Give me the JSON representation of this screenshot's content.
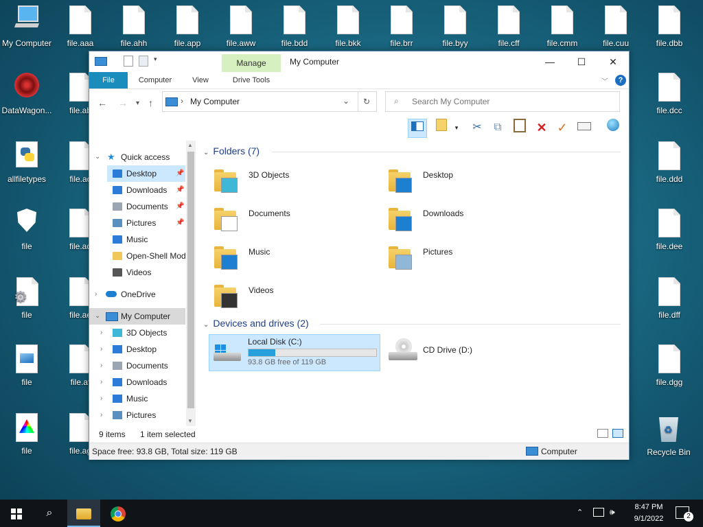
{
  "desktop": {
    "left_icons": [
      {
        "label": "My Computer",
        "kind": "pc"
      },
      {
        "label": "DataWagon...",
        "kind": "web"
      },
      {
        "label": "allfiletypes",
        "kind": "python"
      },
      {
        "label": "file",
        "kind": "shield"
      },
      {
        "label": "file",
        "kind": "gear"
      },
      {
        "label": "file",
        "kind": "image"
      },
      {
        "label": "file",
        "kind": "triangle"
      }
    ],
    "second_column": [
      "file.aaa",
      "file.ab",
      "file.ac",
      "file.ad",
      "file.ae",
      "file.af",
      "file.ag"
    ],
    "top_row": [
      "file.ahh",
      "file.app",
      "file.aww",
      "file.bdd",
      "file.bkk",
      "file.brr",
      "file.byy",
      "file.cff",
      "file.cmm",
      "file.cuu",
      "file.dbb"
    ],
    "right_column": [
      "file.dcc",
      "file.ddd",
      "file.dee",
      "file.dff",
      "file.dgg"
    ],
    "recycle_bin": "Recycle Bin"
  },
  "window": {
    "title": "My Computer",
    "manage_tab": "Manage",
    "ribbon_tabs": [
      "File",
      "Computer",
      "View",
      "Drive Tools"
    ],
    "controls": {
      "minimize": "—",
      "maximize": "☐",
      "close": "✕"
    },
    "address": "My Computer",
    "search_placeholder": "Search My Computer",
    "nav": {
      "quick_access": "Quick access",
      "quick_items": [
        {
          "label": "Desktop",
          "pinned": true,
          "color": "#2b7bd8"
        },
        {
          "label": "Downloads",
          "pinned": true,
          "color": "#2b7bd8"
        },
        {
          "label": "Documents",
          "pinned": true,
          "color": "#9aa6b2"
        },
        {
          "label": "Pictures",
          "pinned": true,
          "color": "#5b8fbf"
        },
        {
          "label": "Music",
          "pinned": false,
          "color": "#2b7bd8"
        },
        {
          "label": "Open-Shell Mod",
          "pinned": false,
          "color": "#f0c85a"
        },
        {
          "label": "Videos",
          "pinned": false,
          "color": "#555555"
        }
      ],
      "onedrive": "OneDrive",
      "my_computer": "My Computer",
      "pc_items": [
        "3D Objects",
        "Desktop",
        "Documents",
        "Downloads",
        "Music",
        "Pictures"
      ]
    },
    "folders_header": "Folders (7)",
    "folders": [
      "3D Objects",
      "Desktop",
      "Documents",
      "Downloads",
      "Music",
      "Pictures",
      "Videos"
    ],
    "drives_header": "Devices and drives (2)",
    "drives": [
      {
        "name": "Local Disk (C:)",
        "free": "93.8 GB free of 119 GB",
        "used_fraction": 0.21
      },
      {
        "name": "CD Drive (D:)"
      }
    ],
    "status": {
      "items": "9 items",
      "selected": "1 item selected",
      "space": "Space free: 93.8 GB, Total size: 119 GB",
      "location": "Computer"
    }
  },
  "taskbar": {
    "time": "8:47 PM",
    "date": "9/1/2022",
    "notifications": "2"
  },
  "colors": {
    "accent": "#1b8dbd",
    "selection": "#cce8ff",
    "taskbar": "#101418"
  }
}
